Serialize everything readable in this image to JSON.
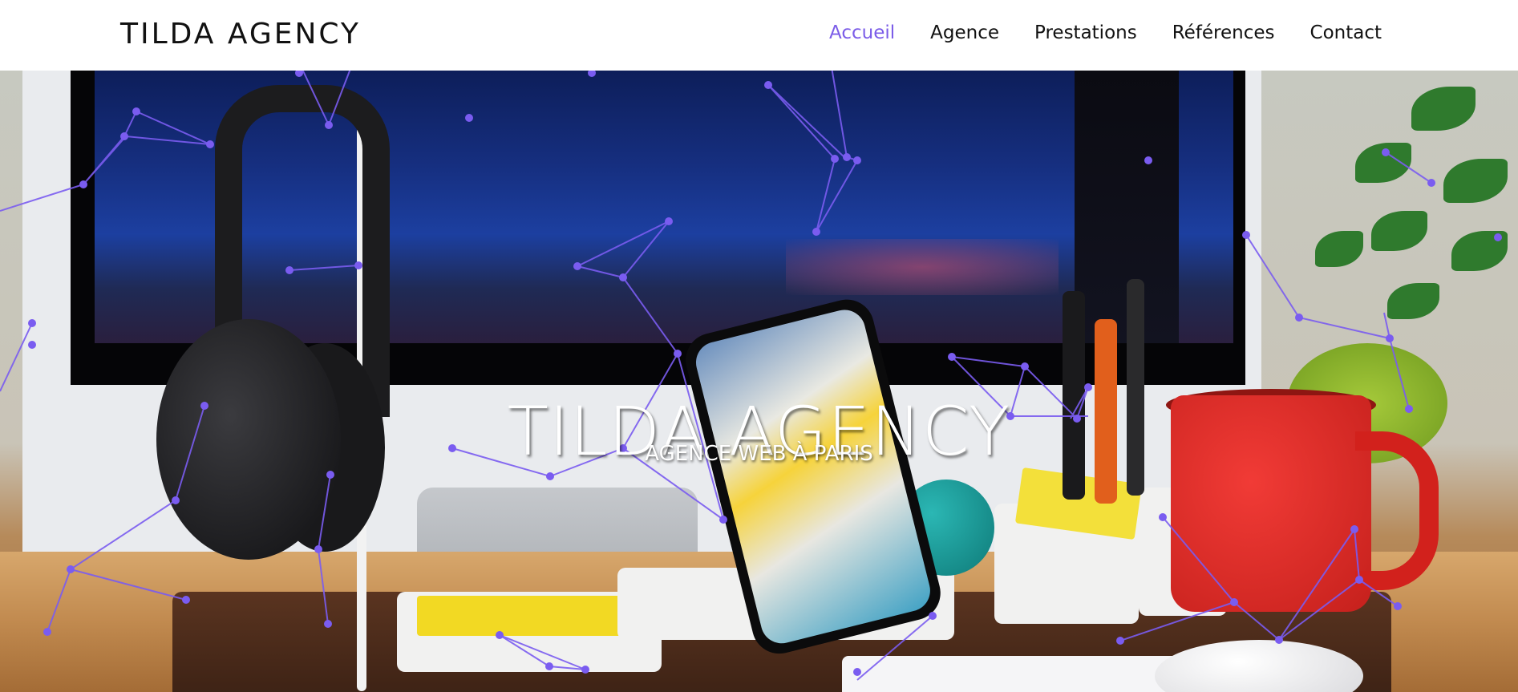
{
  "brand": {
    "name": "TILDA AGENCY"
  },
  "nav": {
    "items": [
      {
        "label": "Accueil",
        "active": true
      },
      {
        "label": "Agence",
        "active": false
      },
      {
        "label": "Prestations",
        "active": false
      },
      {
        "label": "Références",
        "active": false
      },
      {
        "label": "Contact",
        "active": false
      }
    ]
  },
  "hero": {
    "title": "TILDA AGENCY",
    "subtitle": "AGENCE WEB À PARIS"
  },
  "colors": {
    "accent": "#7b5ce8",
    "network": "#7a5cf0",
    "nav_text": "#111111",
    "hero_text": "#ffffff"
  }
}
